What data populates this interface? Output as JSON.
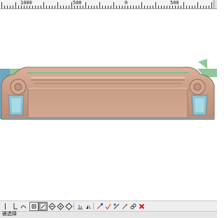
{
  "ruler": {
    "labels": [
      "1000",
      "500",
      "0",
      "500"
    ]
  },
  "canvas": {
    "object_colors": {
      "relief": "#caa088",
      "relief_shadow": "#8e6c58",
      "border_green": "#8dc79a",
      "background": "#ffffff"
    }
  },
  "toolbar": {
    "icons": [
      "vertical-line-icon",
      "perpendicular-icon",
      "undo-curve-icon",
      "select-point-icon",
      "pen-select-icon",
      "diamond-add-icon",
      "diamond-subtract-icon",
      "diamond-icon",
      "align-bottom-icon",
      "align-mirror-icon",
      "node-arrow-icon",
      "node-check-icon",
      "node-move-icon",
      "node-edit-icon",
      "node-link-icon",
      "delete-icon"
    ]
  },
  "status": {
    "text": "被选择"
  }
}
